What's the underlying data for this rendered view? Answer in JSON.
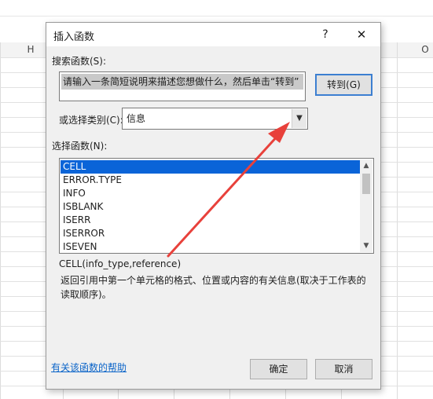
{
  "spreadsheet": {
    "columns": [
      {
        "label": "H"
      },
      {
        "label": "O"
      }
    ]
  },
  "dialog": {
    "title": "插入函数",
    "help": "?",
    "close": "✕",
    "search_label": "搜索函数(S):",
    "search_value": "请输入一条简短说明来描述您想做什么，然后单击“转到”",
    "goto_label": "转到(G)",
    "category_label": "或选择类别(C):",
    "category_value": "信息",
    "select_label": "选择函数(N):",
    "functions": [
      "CELL",
      "ERROR.TYPE",
      "INFO",
      "ISBLANK",
      "ISERR",
      "ISERROR",
      "ISEVEN"
    ],
    "selected_function": "CELL",
    "signature": "CELL(info_type,reference)",
    "description": "返回引用中第一个单元格的格式、位置或内容的有关信息(取决于工作表的读取顺序)。",
    "help_link": "有关该函数的帮助",
    "ok_label": "确定",
    "cancel_label": "取消"
  },
  "colors": {
    "selection": "#0a64d8",
    "annotation_arrow": "#e8413b",
    "link": "#0b64c8"
  }
}
